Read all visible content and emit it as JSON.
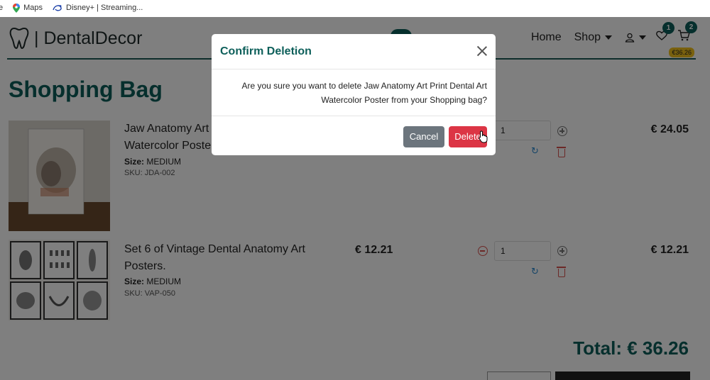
{
  "bookmarks": {
    "items": [
      {
        "label": "e",
        "icon": "truncated-icon"
      },
      {
        "label": "Maps",
        "icon": "maps-pin-icon"
      },
      {
        "label": "Disney+ | Streaming...",
        "icon": "disney-plus-icon"
      }
    ]
  },
  "site": {
    "logo_text": "| DentalDecor",
    "nav": {
      "home": "Home",
      "shop": "Shop",
      "wishlist_count": "1",
      "bag_count": "2",
      "bag_total": "€36.26"
    },
    "page_title": "Shopping Bag"
  },
  "cart": {
    "items": [
      {
        "name_line1": "Jaw Anatomy Art",
        "name_line2": "Watercolor Poste",
        "size_label": "Size:",
        "size_value": "MEDIUM",
        "sku": "SKU: JDA-002",
        "quantity": "1",
        "subtotal": "€ 24.05"
      },
      {
        "name_line1": "Set 6 of Vintage Dental Anatomy Art",
        "name_line2": "Posters.",
        "size_label": "Size:",
        "size_value": "MEDIUM",
        "sku": "SKU: VAP-050",
        "unit_price": "€ 12.21",
        "quantity": "1",
        "subtotal": "€ 12.21"
      }
    ],
    "total": "Total: € 36.26"
  },
  "modal": {
    "title": "Confirm Deletion",
    "message_line1": "Are you sure you want to delete Jaw Anatomy Art Print Dental Art",
    "message_line2": "Watercolor Poster from your Shopping bag?",
    "cancel_label": "Cancel",
    "delete_label": "Delete"
  },
  "colors": {
    "brand": "#0d5f5a",
    "danger": "#dc3545",
    "secondary": "#6c757d",
    "badge_yellow": "#f2c21c"
  }
}
